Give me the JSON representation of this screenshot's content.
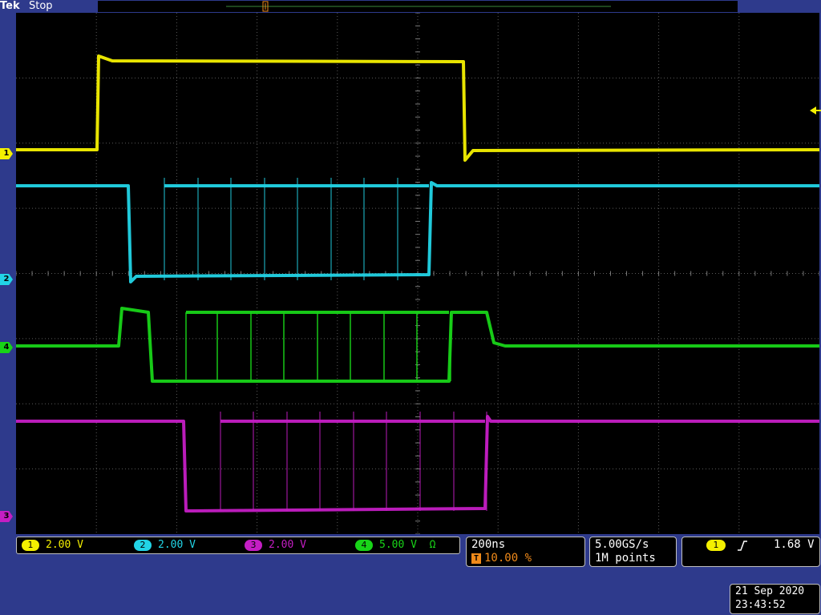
{
  "header": {
    "brand": "Tek",
    "status": "Stop"
  },
  "markers": {
    "trigger_label": "T",
    "ch1": "1",
    "ch2": "2",
    "ch3": "3",
    "ch4": "4"
  },
  "channels": [
    {
      "id": "1",
      "scale": "2.00 V",
      "color": "#f4f000"
    },
    {
      "id": "2",
      "scale": "2.00 V",
      "color": "#22d4e6"
    },
    {
      "id": "3",
      "scale": "2.00 V",
      "color": "#c41ec4"
    },
    {
      "id": "4",
      "scale": "5.00 V",
      "suffix": "Ω",
      "color": "#18d418"
    }
  ],
  "timebase": {
    "scale": "200ns",
    "trigger_position": "10.00 %",
    "trigger_icon": "T"
  },
  "acquisition": {
    "sample_rate": "5.00GS/s",
    "record_length": "1M points"
  },
  "trigger": {
    "source": "1",
    "slope_icon": "rising-edge-icon",
    "level": "1.68 V"
  },
  "datetime": {
    "date": "21 Sep  2020",
    "time": "23:43:52"
  },
  "colors": {
    "ch1": "#f4f000",
    "ch2": "#22d4e6",
    "ch3": "#c41ec4",
    "ch4": "#18d418",
    "trigger": "#f08a1a"
  }
}
